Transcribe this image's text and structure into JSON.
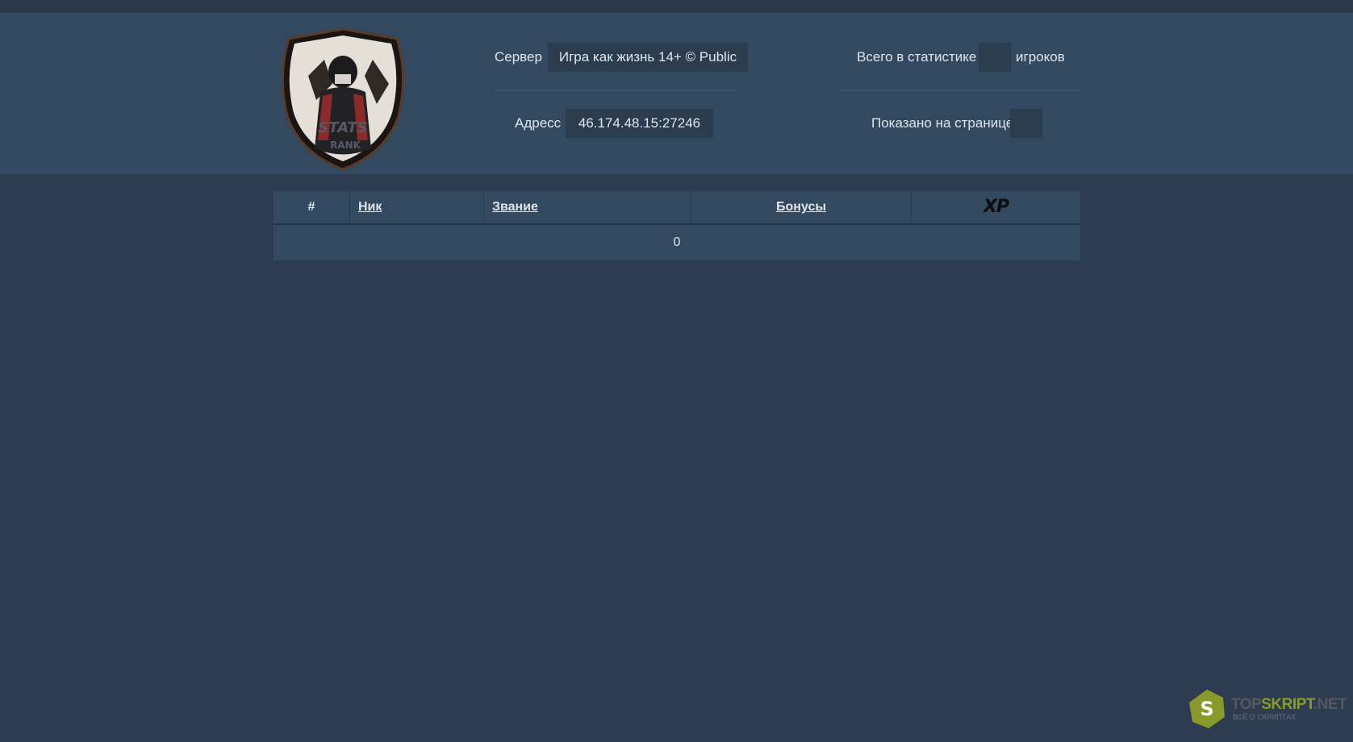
{
  "header": {
    "server_label": "Сервер",
    "server_value": "Игра как жизнь 14+ © Public",
    "address_label": "Адресс",
    "address_value": "46.174.48.15:27246",
    "total_label": "Всего в статистике",
    "total_value": "",
    "total_suffix": "игроков",
    "shown_label": "Показано на странице",
    "shown_value": "",
    "logo_text_1": "STATS",
    "logo_text_2": "RANK"
  },
  "table": {
    "columns": [
      "#",
      "Ник",
      "Звание",
      "Бонусы",
      "XP"
    ],
    "empty_row": "0"
  },
  "watermark": {
    "part1": "TOP",
    "part2": "SKRIPT",
    "part3": ".NET",
    "sub": "ВСЁ О СКРИПТАХ",
    "badge_letter": "S"
  },
  "colors": {
    "background": "#2d3c50",
    "header": "#33495f",
    "box": "#2c3c4f",
    "watermark_green": "#8a9a2a"
  }
}
